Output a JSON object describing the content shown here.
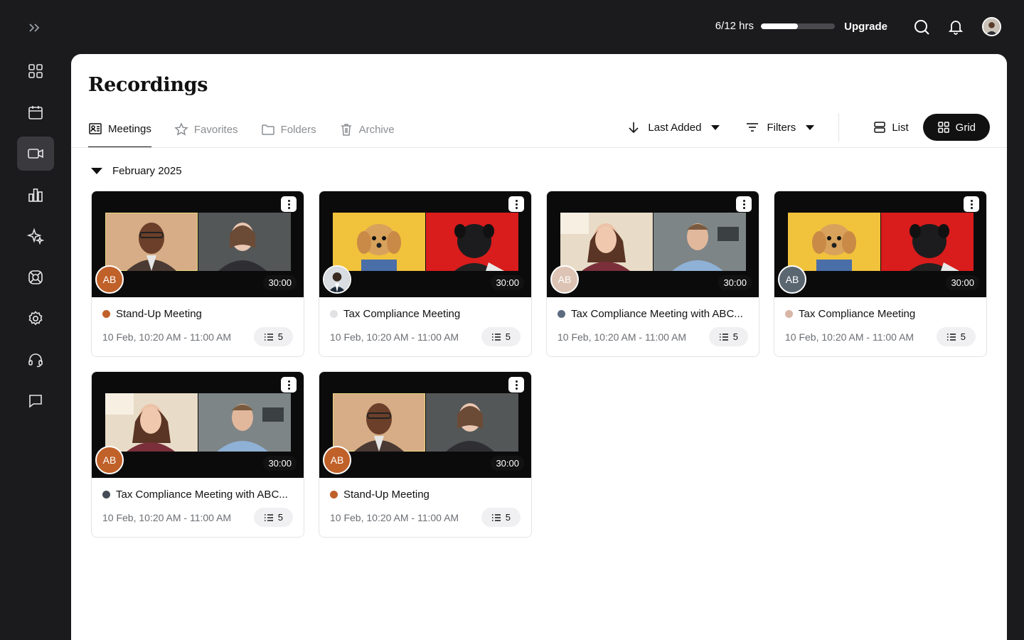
{
  "topbar": {
    "usage_text": "6/12 hrs",
    "usage_fraction": 0.5,
    "upgrade_label": "Upgrade"
  },
  "sidebar": {
    "items": [
      {
        "icon": "dashboard-icon",
        "active": false
      },
      {
        "icon": "calendar-icon",
        "active": false
      },
      {
        "icon": "video-camera-icon",
        "active": true
      },
      {
        "icon": "bar-chart-icon",
        "active": false
      },
      {
        "icon": "sparkle-icon",
        "active": false
      },
      {
        "icon": "integrations-icon",
        "active": false
      },
      {
        "icon": "settings-icon",
        "active": false
      },
      {
        "icon": "headset-icon",
        "active": false
      },
      {
        "icon": "chat-icon",
        "active": false
      }
    ]
  },
  "page": {
    "title": "Recordings",
    "tabs": [
      {
        "label": "Meetings",
        "active": true
      },
      {
        "label": "Favorites",
        "active": false
      },
      {
        "label": "Folders",
        "active": false
      },
      {
        "label": "Archive",
        "active": false
      }
    ],
    "sort_label": "Last Added",
    "filters_label": "Filters",
    "view_list_label": "List",
    "view_grid_label": "Grid",
    "group_label": "February 2025"
  },
  "recordings": [
    {
      "title": "Stand-Up Meeting",
      "date": "10 Feb, 10:20 AM - 11:00 AM",
      "count": "5",
      "duration": "30:00",
      "host": "AB",
      "host_color": "#c0612a",
      "dot_color": "#c0612a",
      "scene": "people"
    },
    {
      "title": "Tax Compliance Meeting",
      "date": "10 Feb, 10:20 AM - 11:00 AM",
      "count": "5",
      "duration": "30:00",
      "host": "",
      "host_color": "#2b2b2b",
      "dot_color": "#e2e2e4",
      "scene": "dogs"
    },
    {
      "title": "Tax Compliance Meeting with ABC...",
      "date": "10 Feb, 10:20 AM - 11:00 AM",
      "count": "5",
      "duration": "30:00",
      "host": "AB",
      "host_color": "#dcc3b3",
      "dot_color": "#5d6b80",
      "scene": "cafe"
    },
    {
      "title": "Tax Compliance Meeting",
      "date": "10 Feb, 10:20 AM - 11:00 AM",
      "count": "5",
      "duration": "30:00",
      "host": "AB",
      "host_color": "#5a6670",
      "dot_color": "#d8b5a6",
      "scene": "dogs"
    },
    {
      "title": "Tax Compliance Meeting with ABC...",
      "date": "10 Feb, 10:20 AM - 11:00 AM",
      "count": "5",
      "duration": "30:00",
      "host": "AB",
      "host_color": "#c0612a",
      "dot_color": "#454c55",
      "scene": "cafe"
    },
    {
      "title": "Stand-Up Meeting",
      "date": "10 Feb, 10:20 AM - 11:00 AM",
      "count": "5",
      "duration": "30:00",
      "host": "AB",
      "host_color": "#c0612a",
      "dot_color": "#c0612a",
      "scene": "people"
    }
  ],
  "colors": {
    "background": "#1b1b1d",
    "panel": "#ffffff",
    "accent": "#111111"
  }
}
